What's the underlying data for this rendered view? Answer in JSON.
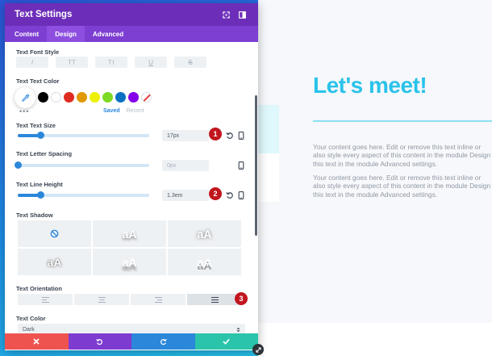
{
  "modal": {
    "title": "Text Settings",
    "tabs": [
      "Content",
      "Design",
      "Advanced"
    ],
    "active_tab": "Design"
  },
  "font_style": {
    "label": "Text Font Style",
    "buttons": [
      "I",
      "TT",
      "Tт",
      "U",
      "S"
    ]
  },
  "text_color": {
    "label": "Text Text Color",
    "more_label": "•••",
    "swatches": [
      "#000000",
      "#ffffff",
      "#e02b20",
      "#e09900",
      "#edf000",
      "#7cda24",
      "#0c71c3",
      "#8300e9"
    ],
    "saved_label": "Saved",
    "recent_label": "Recent"
  },
  "text_size": {
    "label": "Text Text Size",
    "value": "17px",
    "level": 0.17
  },
  "letter_spacing": {
    "label": "Text Letter Spacing",
    "placeholder": "0px",
    "level": 0.0
  },
  "line_height": {
    "label": "Text Line Height",
    "value": "1.3em",
    "level": 0.17
  },
  "text_shadow": {
    "label": "Text Shadow",
    "preview_text": "aA"
  },
  "text_orientation": {
    "label": "Text Orientation",
    "options": [
      "left",
      "center",
      "right",
      "justify"
    ],
    "active": "justify"
  },
  "text_color_select": {
    "label": "Text Color",
    "value": "Dark"
  },
  "badges": [
    "1",
    "2",
    "3"
  ],
  "footer": {
    "colors": [
      "#ef5350",
      "#7e3bd0",
      "#2b87da",
      "#29c4a9"
    ]
  },
  "background_page": {
    "heading": "Let's meet!",
    "paragraph1": [
      "Your content goes here. Edit or remove this text inline or",
      "also style every aspect of this content in the module Design",
      "this text in the module Advanced settings."
    ],
    "paragraph2": [
      "Your content goes here. Edit or remove this text inline or",
      "also style every aspect of this content in the module Design",
      "this text in the module Advanced settings."
    ]
  }
}
